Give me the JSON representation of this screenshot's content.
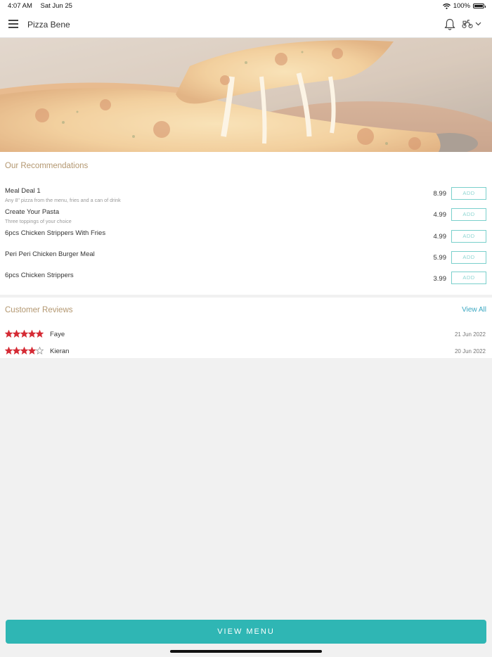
{
  "status_bar": {
    "time": "4:07 AM",
    "date": "Sat Jun 25",
    "battery": "100%"
  },
  "header": {
    "title": "Pizza Bene"
  },
  "recommendations": {
    "title": "Our Recommendations",
    "add_label": "ADD",
    "items": [
      {
        "name": "Meal Deal 1",
        "description": "Any 8\" pizza from the menu, fries and a can of drink",
        "price": "8.99"
      },
      {
        "name": "Create Your Pasta",
        "description": "Three toppings of your choice",
        "price": "4.99"
      },
      {
        "name": "6pcs Chicken Strippers With Fries",
        "description": "",
        "price": "4.99"
      },
      {
        "name": "Peri Peri Chicken Burger Meal",
        "description": "",
        "price": "5.99"
      },
      {
        "name": "6pcs Chicken Strippers",
        "description": "",
        "price": "3.99"
      }
    ]
  },
  "reviews": {
    "title": "Customer Reviews",
    "view_all": "View All",
    "items": [
      {
        "name": "Faye",
        "date": "21 Jun 2022",
        "rating": 5
      },
      {
        "name": "Kieran",
        "date": "20 Jun 2022",
        "rating": 4
      }
    ],
    "star_color": "#d52b35"
  },
  "footer": {
    "view_menu": "VIEW MENU",
    "accent": "#2fb6b4"
  }
}
